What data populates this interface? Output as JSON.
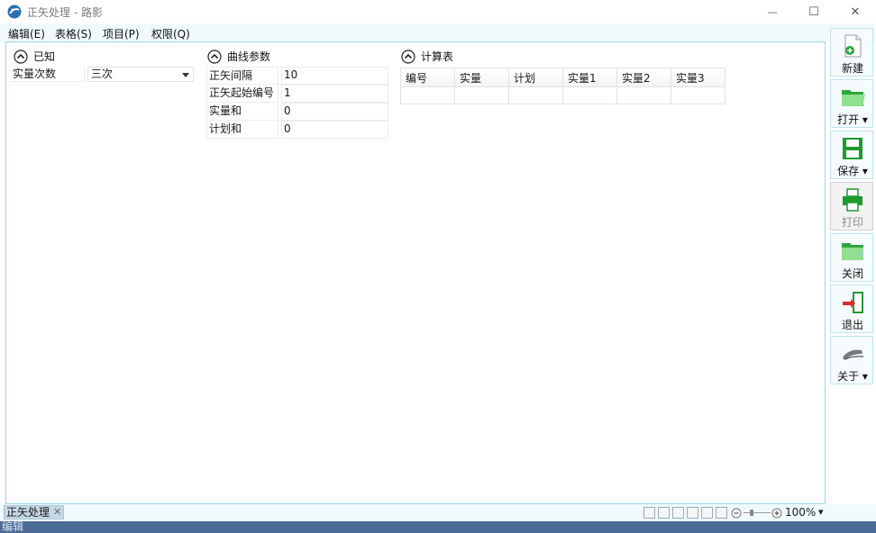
{
  "window": {
    "title": "正矢处理 - 路影",
    "minimize_glyph": "—",
    "maximize_glyph": "☐",
    "close_glyph": "✕"
  },
  "menu": {
    "items": [
      "编辑(E)",
      "表格(S)",
      "项目(P)",
      "权限(Q)"
    ]
  },
  "known": {
    "title": "已知",
    "field_label": "实量次数",
    "field_value": "三次"
  },
  "curve_params": {
    "title": "曲线参数",
    "rows": [
      {
        "label": "正矢间隔",
        "value": "10"
      },
      {
        "label": "正矢起始编号",
        "value": "1"
      },
      {
        "label": "实量和",
        "value": "0"
      },
      {
        "label": "计划和",
        "value": "0"
      }
    ]
  },
  "calc_table": {
    "title": "计算表",
    "columns": [
      "编号",
      "实量",
      "计划",
      "实量1",
      "实量2",
      "实量3"
    ]
  },
  "toolbar": {
    "new": "新建",
    "open": "打开 ▾",
    "save": "保存 ▾",
    "print": "打印",
    "close": "关闭",
    "exit": "退出",
    "about": "关于 ▾"
  },
  "tabs": {
    "active": "正矢处理",
    "close_glyph": "✕"
  },
  "zoom": {
    "level": "100%",
    "dropdown_glyph": "▾"
  },
  "status": {
    "text": "编辑"
  },
  "colors": {
    "accent": "#9fd5e8",
    "statusbar": "#4a6b96",
    "menubar": "#f0fafd",
    "icon_green": "#2aa33a"
  },
  "icons": [
    "app-logo-icon",
    "collapse-up-icon",
    "new-document-icon",
    "open-folder-icon",
    "save-disk-icon",
    "printer-icon",
    "close-folder-icon",
    "exit-door-icon",
    "about-icon",
    "zoom-out-icon",
    "zoom-in-icon"
  ]
}
